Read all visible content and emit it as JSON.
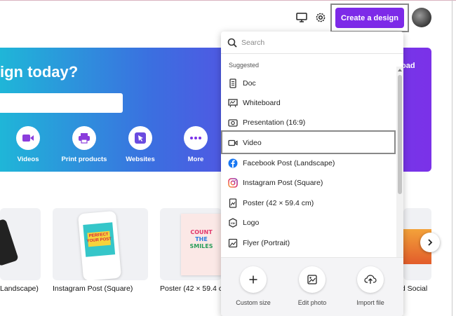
{
  "header": {
    "create_button_label": "Create a design",
    "icons": [
      "desktop-icon",
      "gear-icon"
    ]
  },
  "hero": {
    "title": "ign today?",
    "ghost_button_label": "oad",
    "categories": [
      {
        "label": "Videos",
        "icon": "video-icon",
        "color": "#8b3ddc"
      },
      {
        "label": "Print products",
        "icon": "printer-icon",
        "color": "#8b3ddc"
      },
      {
        "label": "Websites",
        "icon": "cursor-icon",
        "color": "#6a4be0"
      },
      {
        "label": "More",
        "icon": "more-icon",
        "color": "#7b32e8"
      }
    ]
  },
  "cards": [
    {
      "label": "Landscape)"
    },
    {
      "label": "Instagram Post (Square)"
    },
    {
      "label": "Poster (42 × 59.4 c"
    },
    {
      "label": "ed Social"
    }
  ],
  "poster_art": {
    "lines": [
      "COUNT",
      "THE",
      "SMILES"
    ]
  },
  "phone_art": {
    "lines": [
      "PERFECT",
      "YOUR POST"
    ]
  },
  "dropdown": {
    "search_placeholder": "Search",
    "section_label": "Suggested",
    "items": [
      {
        "label": "Doc",
        "icon": "doc-icon"
      },
      {
        "label": "Whiteboard",
        "icon": "whiteboard-icon"
      },
      {
        "label": "Presentation (16:9)",
        "icon": "presentation-icon"
      },
      {
        "label": "Video",
        "icon": "video-icon"
      },
      {
        "label": "Facebook Post (Landscape)",
        "icon": "facebook-icon"
      },
      {
        "label": "Instagram Post (Square)",
        "icon": "instagram-icon"
      },
      {
        "label": "Poster (42 × 59.4 cm)",
        "icon": "poster-icon"
      },
      {
        "label": "Logo",
        "icon": "logo-icon"
      },
      {
        "label": "Flyer (Portrait)",
        "icon": "flyer-icon"
      }
    ],
    "quick_actions": [
      {
        "label": "Custom size",
        "icon": "plus-icon"
      },
      {
        "label": "Edit photo",
        "icon": "image-edit-icon"
      },
      {
        "label": "Import file",
        "icon": "upload-icon"
      }
    ]
  },
  "colors": {
    "accent": "#7d2ae8",
    "facebook": "#1877f2"
  }
}
